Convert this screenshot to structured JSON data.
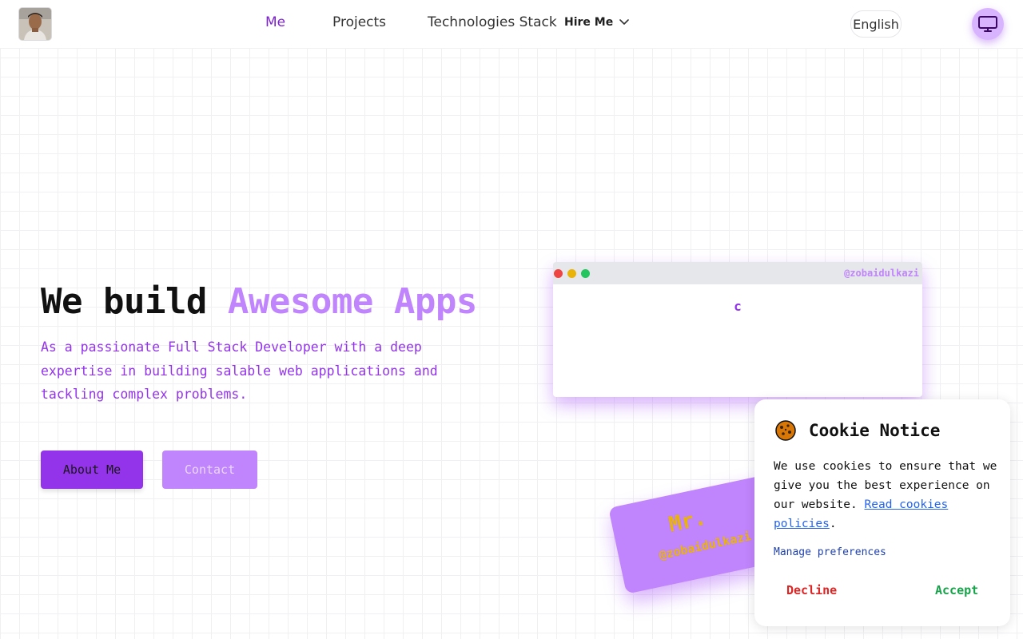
{
  "header": {
    "nav": [
      {
        "label": "Me",
        "active": true
      },
      {
        "label": "Projects",
        "active": false
      },
      {
        "label": "Technologies Stack",
        "active": false
      }
    ],
    "hire_label": "Hire Me",
    "language": "English",
    "avatar_icon": "profile-photo",
    "theme_icon": "monitor-icon"
  },
  "hero": {
    "title_plain": "We build ",
    "title_accent": "Awesome Apps",
    "description": "As a passionate Full Stack Developer with a deep expertise in building salable web applications and tackling complex problems.",
    "about_button": "About Me",
    "contact_button": "Contact"
  },
  "code_window": {
    "handle": "@zobaidulkazi",
    "typed_text": "c"
  },
  "card": {
    "title": "Mr.",
    "handle": "@zobaidulkazi"
  },
  "cookie": {
    "title": "Cookie Notice",
    "text": "We use cookies to ensure that we give you the best experience on our website.",
    "link": "Read cookies policies",
    "link_suffix": ".",
    "manage": "Manage preferences",
    "decline": "Decline",
    "accept": "Accept"
  },
  "colors": {
    "accent": "#9333ea",
    "accent_light": "#c084fc",
    "nav_active": "#7e22ce",
    "decline": "#dc2626",
    "accept": "#16a34a"
  }
}
